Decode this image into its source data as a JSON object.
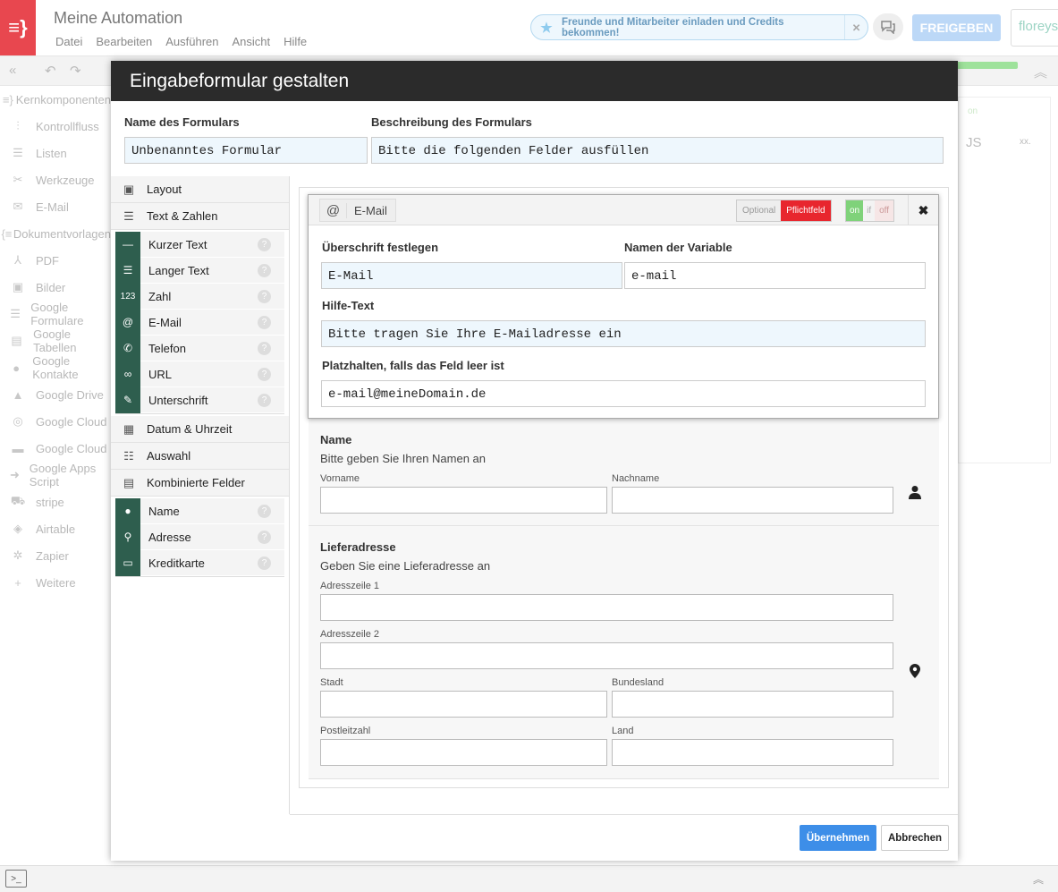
{
  "app": {
    "title": "Meine Automation",
    "menu": [
      "Datei",
      "Bearbeiten",
      "Ausführen",
      "Ansicht",
      "Hilfe"
    ],
    "invite_text": "Freunde und Mitarbeiter einladen und Credits bekommen!",
    "share_label": "FREIGEBEN",
    "brand": "floreys"
  },
  "sidebar": {
    "items": [
      {
        "label": "Kernkomponenten",
        "icon": "braces-icon"
      },
      {
        "label": "Kontrollfluss",
        "icon": "flow-icon"
      },
      {
        "label": "Listen",
        "icon": "list-icon"
      },
      {
        "label": "Werkzeuge",
        "icon": "tools-icon"
      },
      {
        "label": "E-Mail",
        "icon": "mail-icon"
      },
      {
        "label": "Dokumentvorlagen",
        "icon": "doc-braces-icon"
      },
      {
        "label": "PDF",
        "icon": "pdf-icon"
      },
      {
        "label": "Bilder",
        "icon": "image-icon"
      },
      {
        "label": "Google Formulare",
        "icon": "list-icon"
      },
      {
        "label": "Google Tabellen",
        "icon": "table-icon"
      },
      {
        "label": "Google Kontakte",
        "icon": "person-icon"
      },
      {
        "label": "Google Drive",
        "icon": "drive-icon"
      },
      {
        "label": "Google Cloud",
        "icon": "cloud-icon"
      },
      {
        "label": "Google Cloud",
        "icon": "print-icon"
      },
      {
        "label": "Google Apps Script",
        "icon": "arrow-icon"
      },
      {
        "label": "stripe",
        "icon": "cart-icon"
      },
      {
        "label": "Airtable",
        "icon": "airtable-icon"
      },
      {
        "label": "Zapier",
        "icon": "gear-icon"
      },
      {
        "label": "Weitere",
        "icon": "plus-icon"
      }
    ]
  },
  "modal": {
    "title": "Eingabeformular gestalten",
    "form_name_label": "Name des Formulars",
    "form_name_value": "Unbenanntes Formular",
    "form_desc_label": "Beschreibung des Formulars",
    "form_desc_value": "Bitte die folgenden Felder ausfüllen",
    "palette": {
      "layout": "Layout",
      "text_numbers": "Text & Zahlen",
      "text_fields": [
        {
          "label": "Kurzer Text",
          "icon": "short-text-icon"
        },
        {
          "label": "Langer Text",
          "icon": "long-text-icon"
        },
        {
          "label": "Zahl",
          "icon": "number-icon"
        },
        {
          "label": "E-Mail",
          "icon": "at-icon"
        },
        {
          "label": "Telefon",
          "icon": "phone-icon"
        },
        {
          "label": "URL",
          "icon": "link-icon"
        },
        {
          "label": "Unterschrift",
          "icon": "pen-icon"
        }
      ],
      "datetime": "Datum & Uhrzeit",
      "choice": "Auswahl",
      "combined": "Kombinierte Felder",
      "combined_fields": [
        {
          "label": "Name",
          "icon": "person-icon"
        },
        {
          "label": "Adresse",
          "icon": "map-pin-icon"
        },
        {
          "label": "Kreditkarte",
          "icon": "credit-card-icon"
        }
      ]
    },
    "editor": {
      "field_type": "E-Mail",
      "optional": "Optional",
      "required": "Pflichtfeld",
      "on": "on",
      "if": "if",
      "off": "off",
      "heading_label": "Überschrift festlegen",
      "heading_value": "E-Mail",
      "varname_label": "Namen der Variable",
      "varname_value": "e-mail",
      "help_label": "Hilfe-Text",
      "help_value": "Bitte tragen Sie Ihre E-Mailadresse ein",
      "placeholder_label": "Platzhalten, falls das Feld leer ist",
      "placeholder_value": "e-mail@meineDomain.de"
    },
    "name_section": {
      "title": "Name",
      "desc": "Bitte geben Sie Ihren Namen an",
      "first": "Vorname",
      "last": "Nachname"
    },
    "address_section": {
      "title": "Lieferadresse",
      "desc": "Geben Sie eine Lieferadresse an",
      "line1": "Adresszeile 1",
      "line2": "Adresszeile 2",
      "city": "Stadt",
      "state": "Bundesland",
      "zip": "Postleitzahl",
      "country": "Land"
    },
    "apply": "Übernehmen",
    "cancel": "Abbrechen"
  },
  "right_panel": {
    "js": "JS",
    "xx": "xx."
  },
  "colors": {
    "accent": "#e8474f",
    "palette_icon_bg": "#2e5e4e",
    "apply_btn": "#3d8ee8",
    "required": "#e8262e",
    "on": "#7fd27a"
  }
}
